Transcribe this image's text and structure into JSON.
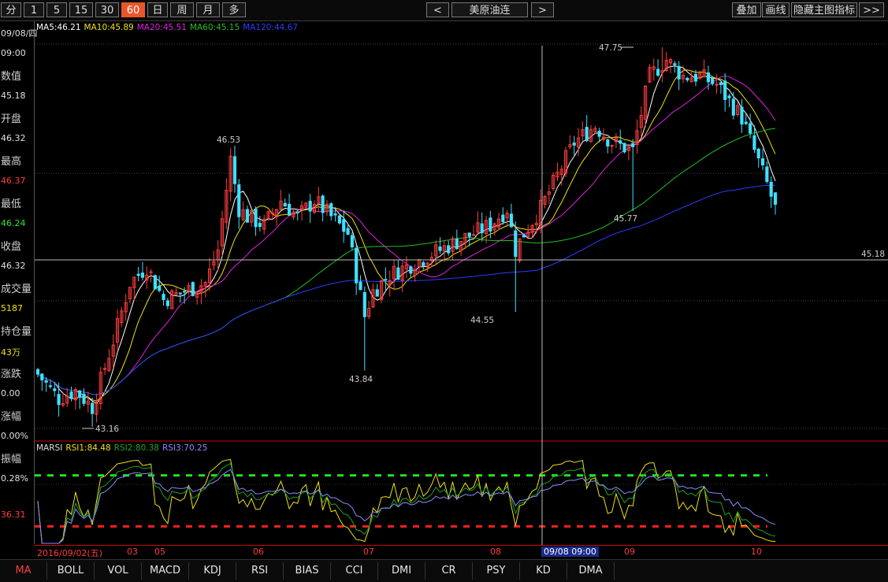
{
  "toolbar": {
    "periods": [
      "分",
      "1",
      "5",
      "15",
      "30",
      "60",
      "日",
      "周",
      "月",
      "多"
    ],
    "active_period": "60",
    "prev_label": "<",
    "contract": "美原油连",
    "next_label": ">",
    "right_buttons": [
      "叠加",
      "画线",
      "隐藏主图指标",
      ">>"
    ]
  },
  "info_panel": {
    "date": "09/08/四",
    "time": "09:00",
    "value_label": "数值",
    "value": "45.18",
    "open_label": "开盘",
    "open": "46.32",
    "high_label": "最高",
    "high": "46.37",
    "low_label": "最低",
    "low": "46.24",
    "close_label": "收盘",
    "close": "46.32",
    "volume_label": "成交量",
    "volume": "5187",
    "oi_label": "持仓量",
    "oi": "43万",
    "change_label": "涨跌",
    "change": "0.00",
    "pct_label": "涨幅",
    "pct": "0.00%",
    "amp_label": "振幅",
    "amp": "0.28%",
    "rsi_axis_value": "36.31"
  },
  "ma_legend": [
    {
      "label": "MA5:46.21",
      "color": "#ffffff"
    },
    {
      "label": "MA10:45.89",
      "color": "#f0e010"
    },
    {
      "label": "MA20:45.51",
      "color": "#e020e0"
    },
    {
      "label": "MA60:45.15",
      "color": "#22c022"
    },
    {
      "label": "MA120:44.67",
      "color": "#2a3cff"
    }
  ],
  "rsi_legend": [
    {
      "label": "MARSI",
      "color": "#dddddd"
    },
    {
      "label": "RSI1:84.48",
      "color": "#f0e010"
    },
    {
      "label": "RSI2:80.38",
      "color": "#22a022"
    },
    {
      "label": "RSI3:70.25",
      "color": "#8a8cff"
    }
  ],
  "annotations": {
    "high": "47.75",
    "left_low": "43.16",
    "peak1": "46.53",
    "trough": "43.84",
    "low2": "44.55",
    "low3": "45.77",
    "crosshair_value": "45.18"
  },
  "xaxis": {
    "labels": [
      "2016/09/02(五)",
      "03",
      "05",
      "06",
      "07",
      "08",
      "09/08 09:00",
      "09",
      "10"
    ]
  },
  "bottom_tabs": [
    "MA",
    "BOLL",
    "VOL",
    "MACD",
    "KDJ",
    "RSI",
    "BIAS",
    "CCI",
    "DMI",
    "CR",
    "PSY",
    "KD",
    "DMA"
  ],
  "active_tab": "MA",
  "colors": {
    "up": "#ff3b3b",
    "down": "#3fe0ff",
    "ma5": "#ffffff",
    "ma10": "#f0e010",
    "ma20": "#e020e0",
    "ma60": "#22c022",
    "ma120": "#2a3cff",
    "rsi1": "#f0e010",
    "rsi2": "#22a022",
    "rsi3": "#8a8cff",
    "overbought_line": "#22e022",
    "oversold_line": "#ff2020"
  },
  "chart_data": {
    "type": "candlestick",
    "price_range": [
      43.16,
      47.75
    ],
    "close_anchors": [
      [
        0,
        43.8
      ],
      [
        5,
        43.5
      ],
      [
        9,
        43.6
      ],
      [
        13,
        43.4
      ],
      [
        18,
        44.2
      ],
      [
        22,
        44.9
      ],
      [
        26,
        45.1
      ],
      [
        30,
        44.7
      ],
      [
        35,
        44.8
      ],
      [
        40,
        44.9
      ],
      [
        43,
        45.3
      ],
      [
        46,
        46.4
      ],
      [
        48,
        45.8
      ],
      [
        50,
        45.7
      ],
      [
        54,
        45.6
      ],
      [
        58,
        45.9
      ],
      [
        62,
        45.7
      ],
      [
        66,
        45.9
      ],
      [
        70,
        45.7
      ],
      [
        74,
        45.5
      ],
      [
        76,
        45.0
      ],
      [
        78,
        44.5
      ],
      [
        80,
        44.8
      ],
      [
        84,
        45.0
      ],
      [
        88,
        45.1
      ],
      [
        92,
        45.2
      ],
      [
        96,
        45.3
      ],
      [
        100,
        45.4
      ],
      [
        104,
        45.5
      ],
      [
        108,
        45.6
      ],
      [
        112,
        45.8
      ],
      [
        114,
        45.3
      ],
      [
        116,
        45.5
      ],
      [
        120,
        45.8
      ],
      [
        125,
        46.3
      ],
      [
        128,
        46.6
      ],
      [
        133,
        46.8
      ],
      [
        137,
        46.6
      ],
      [
        142,
        46.5
      ],
      [
        146,
        47.4
      ],
      [
        150,
        47.6
      ],
      [
        154,
        47.4
      ],
      [
        158,
        47.4
      ],
      [
        162,
        47.3
      ],
      [
        165,
        47.1
      ],
      [
        168,
        46.9
      ],
      [
        171,
        46.5
      ],
      [
        174,
        46.1
      ],
      [
        176,
        45.8
      ]
    ],
    "candle_count": 177,
    "rsi_range": [
      0,
      100
    ],
    "rsi_levels": [
      80,
      20
    ]
  }
}
